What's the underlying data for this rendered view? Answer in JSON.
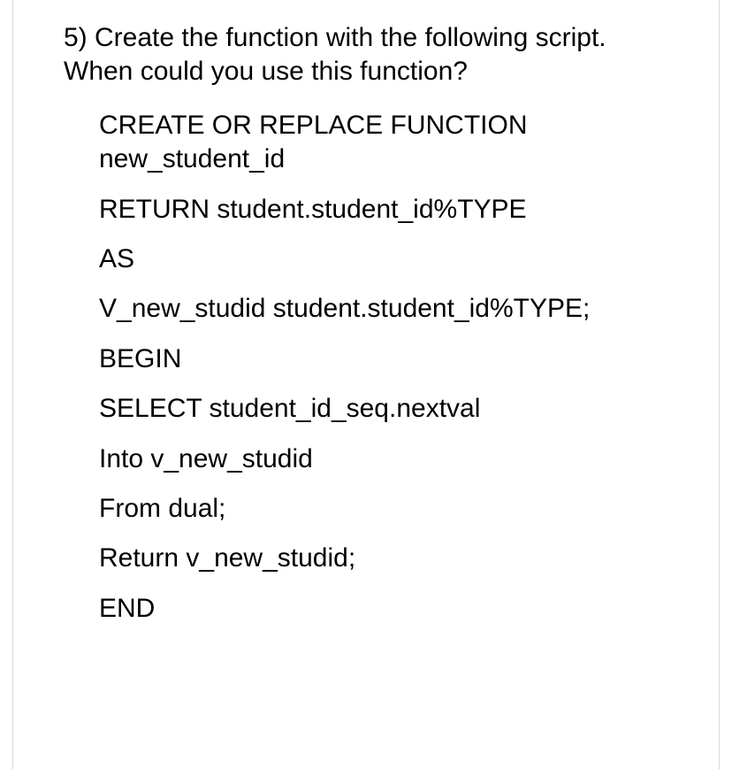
{
  "question": "5) Create the function with the following script. When could you use this function?",
  "code": {
    "lines": [
      "CREATE OR REPLACE FUNCTION new_student_id",
      "RETURN student.student_id%TYPE",
      "AS",
      "V_new_studid student.student_id%TYPE;",
      "BEGIN",
      "SELECT student_id_seq.nextval",
      "Into v_new_studid",
      "From dual;",
      "Return v_new_studid;",
      "END"
    ]
  }
}
